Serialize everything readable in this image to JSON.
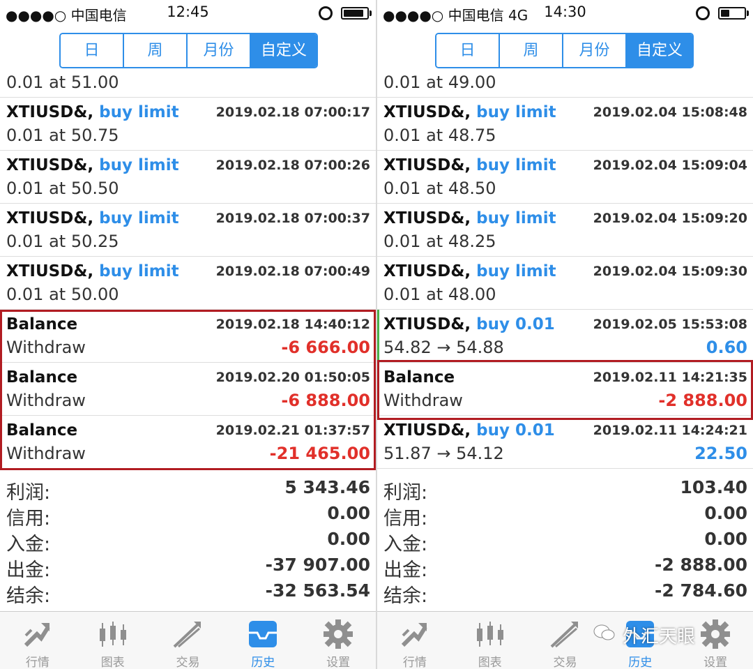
{
  "left": {
    "status": {
      "carrier": "●●●●○ 中国电信",
      "time": "12:45"
    },
    "segments": [
      "日",
      "周",
      "月份",
      "自定义"
    ],
    "partial_row": "0.01 at 51.00",
    "rows": [
      {
        "symbol": "XTIUSD&,",
        "type": "buy limit",
        "date": "2019.02.18 07:00:17",
        "detail": "0.01 at 50.75",
        "amount": ""
      },
      {
        "symbol": "XTIUSD&,",
        "type": "buy limit",
        "date": "2019.02.18 07:00:26",
        "detail": "0.01 at 50.50",
        "amount": ""
      },
      {
        "symbol": "XTIUSD&,",
        "type": "buy limit",
        "date": "2019.02.18 07:00:37",
        "detail": "0.01 at 50.25",
        "amount": ""
      },
      {
        "symbol": "XTIUSD&,",
        "type": "buy limit",
        "date": "2019.02.18 07:00:49",
        "detail": "0.01 at 50.00",
        "amount": ""
      },
      {
        "symbol": "Balance",
        "type": "",
        "date": "2019.02.18 14:40:12",
        "detail": "Withdraw",
        "amount": "-6 666.00"
      },
      {
        "symbol": "Balance",
        "type": "",
        "date": "2019.02.20 01:50:05",
        "detail": "Withdraw",
        "amount": "-6 888.00"
      },
      {
        "symbol": "Balance",
        "type": "",
        "date": "2019.02.21 01:37:57",
        "detail": "Withdraw",
        "amount": "-21 465.00"
      }
    ],
    "summary": [
      {
        "label": "利润:",
        "value": "5 343.46"
      },
      {
        "label": "信用:",
        "value": "0.00"
      },
      {
        "label": "入金:",
        "value": "0.00"
      },
      {
        "label": "出金:",
        "value": "-37 907.00"
      },
      {
        "label": "结余:",
        "value": "-32 563.54"
      }
    ]
  },
  "right": {
    "status": {
      "carrier": "●●●●○ 中国电信   4G",
      "time": "14:30"
    },
    "segments": [
      "日",
      "周",
      "月份",
      "自定义"
    ],
    "partial_row": "0.01 at 49.00",
    "rows": [
      {
        "symbol": "XTIUSD&,",
        "type": "buy limit",
        "date": "2019.02.04 15:08:48",
        "detail": "0.01 at 48.75",
        "amount": ""
      },
      {
        "symbol": "XTIUSD&,",
        "type": "buy limit",
        "date": "2019.02.04 15:09:04",
        "detail": "0.01 at 48.50",
        "amount": ""
      },
      {
        "symbol": "XTIUSD&,",
        "type": "buy limit",
        "date": "2019.02.04 15:09:20",
        "detail": "0.01 at 48.25",
        "amount": ""
      },
      {
        "symbol": "XTIUSD&,",
        "type": "buy limit",
        "date": "2019.02.04 15:09:30",
        "detail": "0.01 at 48.00",
        "amount": ""
      },
      {
        "symbol": "XTIUSD&,",
        "type": "buy 0.01",
        "date": "2019.02.05 15:53:08",
        "detail": "54.82 → 54.88",
        "amount": "0.60"
      },
      {
        "symbol": "Balance",
        "type": "",
        "date": "2019.02.11 14:21:35",
        "detail": "Withdraw",
        "amount": "-2 888.00"
      },
      {
        "symbol": "XTIUSD&,",
        "type": "buy 0.01",
        "date": "2019.02.11 14:24:21",
        "detail": "51.87 → 54.12",
        "amount": "22.50"
      }
    ],
    "summary": [
      {
        "label": "利润:",
        "value": "103.40"
      },
      {
        "label": "信用:",
        "value": "0.00"
      },
      {
        "label": "入金:",
        "value": "0.00"
      },
      {
        "label": "出金:",
        "value": "-2 888.00"
      },
      {
        "label": "结余:",
        "value": "-2 784.60"
      }
    ]
  },
  "tabs": [
    {
      "label": "行情",
      "icon": "quotes-icon"
    },
    {
      "label": "图表",
      "icon": "chart-icon"
    },
    {
      "label": "交易",
      "icon": "trade-icon"
    },
    {
      "label": "历史",
      "icon": "history-icon",
      "active": true
    },
    {
      "label": "设置",
      "icon": "settings-icon"
    }
  ],
  "watermark": "外汇天眼",
  "colors": {
    "accent": "#2e8ee8",
    "negative": "#e1302a",
    "highlight_box": "#b11c22"
  }
}
